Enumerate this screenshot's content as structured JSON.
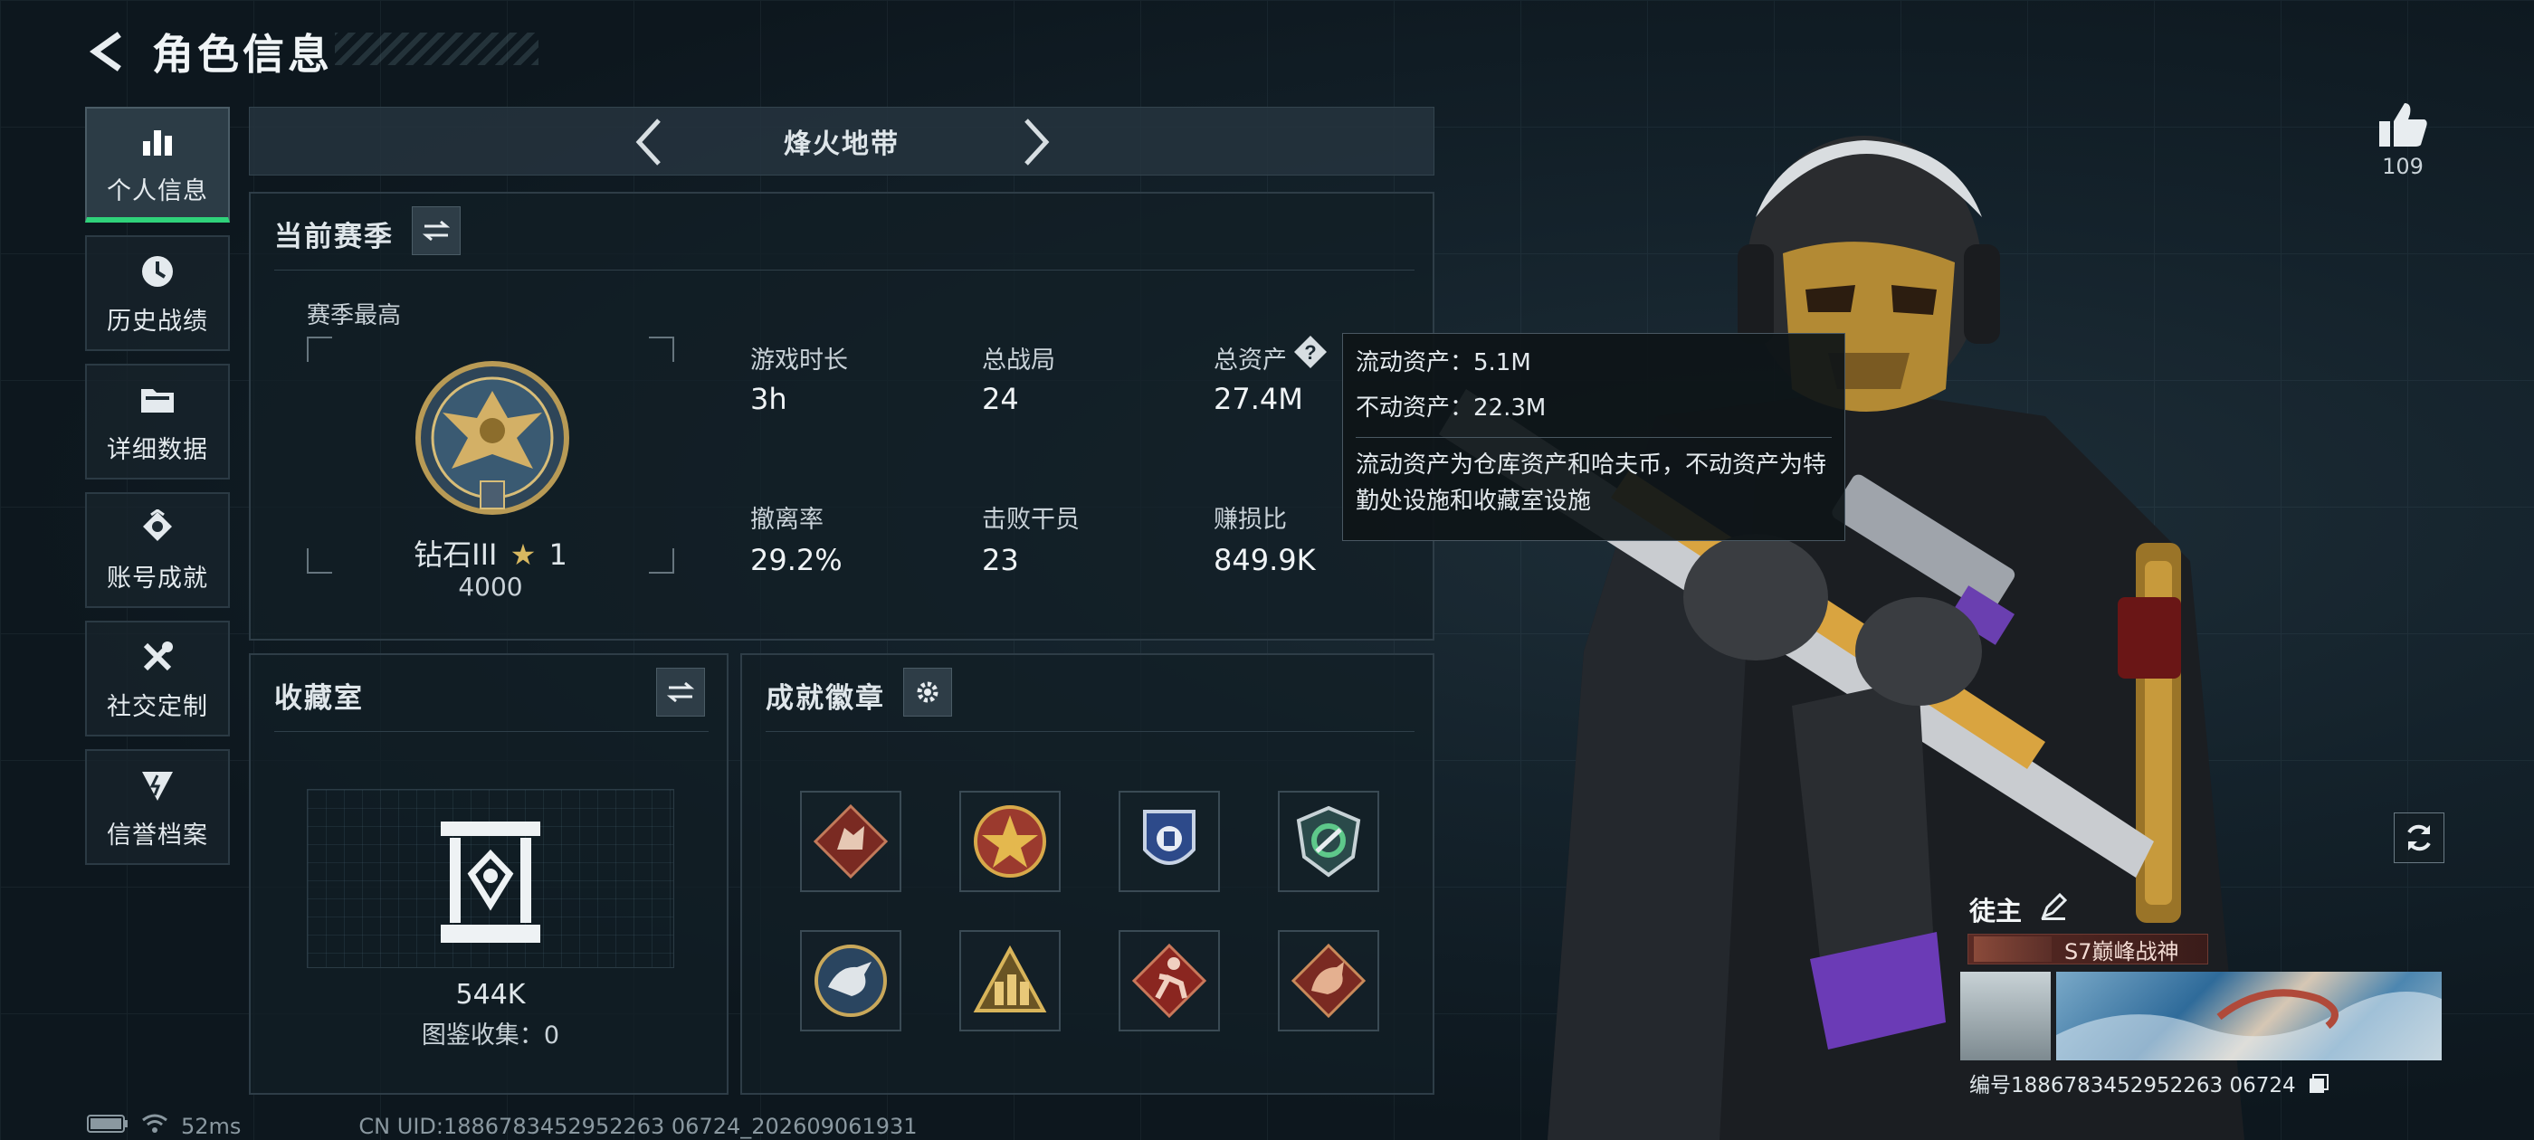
{
  "header": {
    "title": "角色信息"
  },
  "nav": [
    {
      "label": "个人信息",
      "icon": "bar-chart-icon",
      "active": true
    },
    {
      "label": "历史战绩",
      "icon": "history-clock-icon",
      "active": false
    },
    {
      "label": "详细数据",
      "icon": "folder-icon",
      "active": false
    },
    {
      "label": "账号成就",
      "icon": "achievement-icon",
      "active": false
    },
    {
      "label": "社交定制",
      "icon": "tools-icon",
      "active": false
    },
    {
      "label": "信誉档案",
      "icon": "shield-icon",
      "active": false
    }
  ],
  "mode": {
    "title": "烽火地带"
  },
  "season": {
    "title": "当前赛季",
    "season_high_label": "赛季最高",
    "rank_name": "钻石III",
    "rank_stars": "1",
    "rank_score": "4000",
    "stats": [
      {
        "label": "游戏时长",
        "value": "3h"
      },
      {
        "label": "总战局",
        "value": "24"
      },
      {
        "label": "总资产",
        "value": "27.4M"
      },
      {
        "label": "撤离率",
        "value": "29.2%"
      },
      {
        "label": "击败干员",
        "value": "23"
      },
      {
        "label": "赚损比",
        "value": "849.9K"
      }
    ]
  },
  "tooltip": {
    "liquid": "流动资产：5.1M",
    "fixed": "不动资产：22.3M",
    "note": "流动资产为仓库资产和哈夫币，不动资产为特勤处设施和收藏室设施"
  },
  "collection": {
    "title": "收藏室",
    "value": "544K",
    "count_label": "图鉴收集：0"
  },
  "achievements": {
    "title": "成就徽章",
    "badges": [
      "wolf-badge-icon",
      "star-emblem-icon",
      "police-badge-icon",
      "green-shield-icon",
      "eagle-badge-icon",
      "soldiers-triangle-icon",
      "runner-badge-icon",
      "dragon-badge-icon"
    ]
  },
  "status": {
    "ping": "52ms",
    "uid": "CN UID:1886783452952263 06724_202609061931"
  },
  "operator": {
    "likes": "109",
    "name": "徒主",
    "title": "S7巅峰战神",
    "id": "编号1886783452952263 06724"
  },
  "colors": {
    "accent_green": "#2fd27a",
    "panel_border": "#2e3d47",
    "background": "#0f1a22"
  }
}
